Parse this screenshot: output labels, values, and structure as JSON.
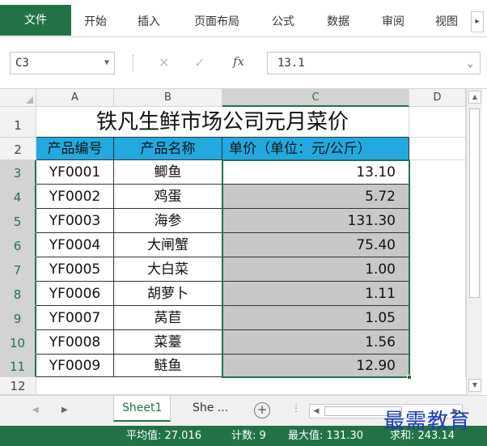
{
  "ribbon": {
    "tabs": [
      "文件",
      "开始",
      "插入",
      "页面布局",
      "公式",
      "数据",
      "审阅",
      "视图"
    ],
    "scroll_icon": "chevron-right-icon"
  },
  "formula_bar": {
    "name_box": "C3",
    "cancel_icon": "✕",
    "enter_icon": "✓",
    "fx_label": "fx",
    "value": "13.1"
  },
  "grid": {
    "columns": [
      "A",
      "B",
      "C",
      "D"
    ],
    "rows": [
      "1",
      "2",
      "3",
      "4",
      "5",
      "6",
      "7",
      "8",
      "9",
      "10",
      "11",
      "12"
    ],
    "title": "铁凡生鲜市场公司元月菜价",
    "headers": [
      "产品编号",
      "产品名称",
      "单价（单位：元/公斤）"
    ],
    "data": [
      [
        "YF0001",
        "鲫鱼",
        "13.10"
      ],
      [
        "YF0002",
        "鸡蛋",
        "5.72"
      ],
      [
        "YF0003",
        "海参",
        "131.30"
      ],
      [
        "YF0004",
        "大闸蟹",
        "75.40"
      ],
      [
        "YF0005",
        "大白菜",
        "1.00"
      ],
      [
        "YF0006",
        "胡萝卜",
        "1.11"
      ],
      [
        "YF0007",
        "莴苣",
        "1.05"
      ],
      [
        "YF0008",
        "菜薹",
        "1.56"
      ],
      [
        "YF0009",
        "鲢鱼",
        "12.90"
      ]
    ],
    "header_fill": "#22a9e0",
    "selection_color": "#217346"
  },
  "sheets": {
    "tabs": [
      "Sheet1",
      "She ..."
    ],
    "active": "Sheet1",
    "add_label": "+"
  },
  "status": {
    "average": "平均值: 27.016",
    "count": "计数: 9",
    "max": "最大值: 131.30",
    "sum": "求和: 243.14"
  },
  "watermark": "最需教育",
  "theme": {
    "accent": "#217346"
  }
}
